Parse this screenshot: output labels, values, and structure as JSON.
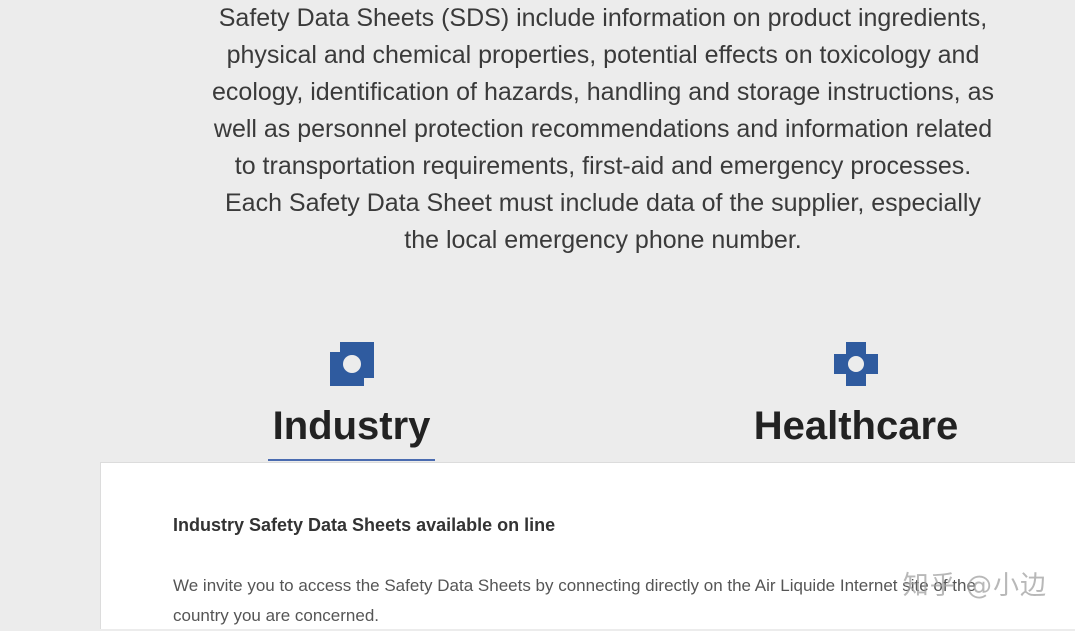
{
  "intro": {
    "paragraph1": "Safety Data Sheets (SDS) include information on product ingredients, physical and chemical properties, potential effects on toxicology and ecology, identification of hazards, handling and storage instructions, as well as personnel protection recommendations and information related to transportation requirements, first-aid and emergency processes.",
    "paragraph2": "Each Safety Data Sheet must include data of the supplier, especially the local emergency phone number."
  },
  "tabs": [
    {
      "label": "Industry",
      "icon": "industry-icon",
      "active": true
    },
    {
      "label": "Healthcare",
      "icon": "healthcare-cross-icon",
      "active": false
    }
  ],
  "panel": {
    "title": "Industry Safety Data Sheets available on line",
    "body": "We invite you to access the Safety Data Sheets by connecting directly on the Air Liquide Internet site of the country you are concerned."
  },
  "watermark": "知乎 @小边",
  "colors": {
    "accent": "#2f5b9f",
    "underline": "#4a6bb0",
    "background": "#ececec",
    "panel": "#ffffff"
  }
}
